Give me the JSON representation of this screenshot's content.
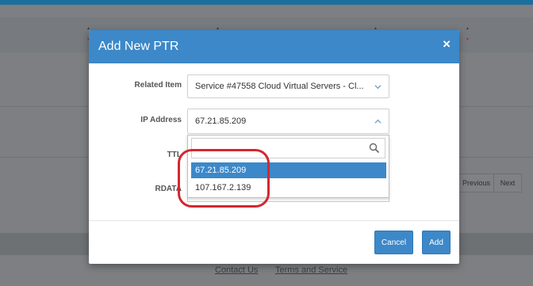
{
  "modal": {
    "title": "Add New PTR",
    "close_symbol": "×",
    "related_item": {
      "label": "Related Item",
      "value": "Service #47558 Cloud Virtual Servers - Cl..."
    },
    "ip_address": {
      "label": "IP Address",
      "value": "67.21.85.209",
      "search_value": "",
      "options": [
        {
          "text": "67.21.85.209",
          "selected": true
        },
        {
          "text": "107.167.2.139",
          "selected": false
        }
      ]
    },
    "ttl": {
      "label": "TTL"
    },
    "rdata": {
      "label": "RDATA"
    },
    "cancel_label": "Cancel",
    "add_label": "Add"
  },
  "background": {
    "pagination": {
      "previous": "Previous",
      "next": "Next"
    },
    "footer": {
      "contact": "Contact Us",
      "terms": "Terms and Service"
    }
  },
  "colors": {
    "accent": "#3c88c9",
    "overlay": "#7d7f82",
    "annotation": "#d42730"
  },
  "icons": {
    "chevron_down": "chevron-down-icon",
    "chevron_up": "chevron-up-icon",
    "search": "search-icon",
    "close": "close-icon"
  }
}
